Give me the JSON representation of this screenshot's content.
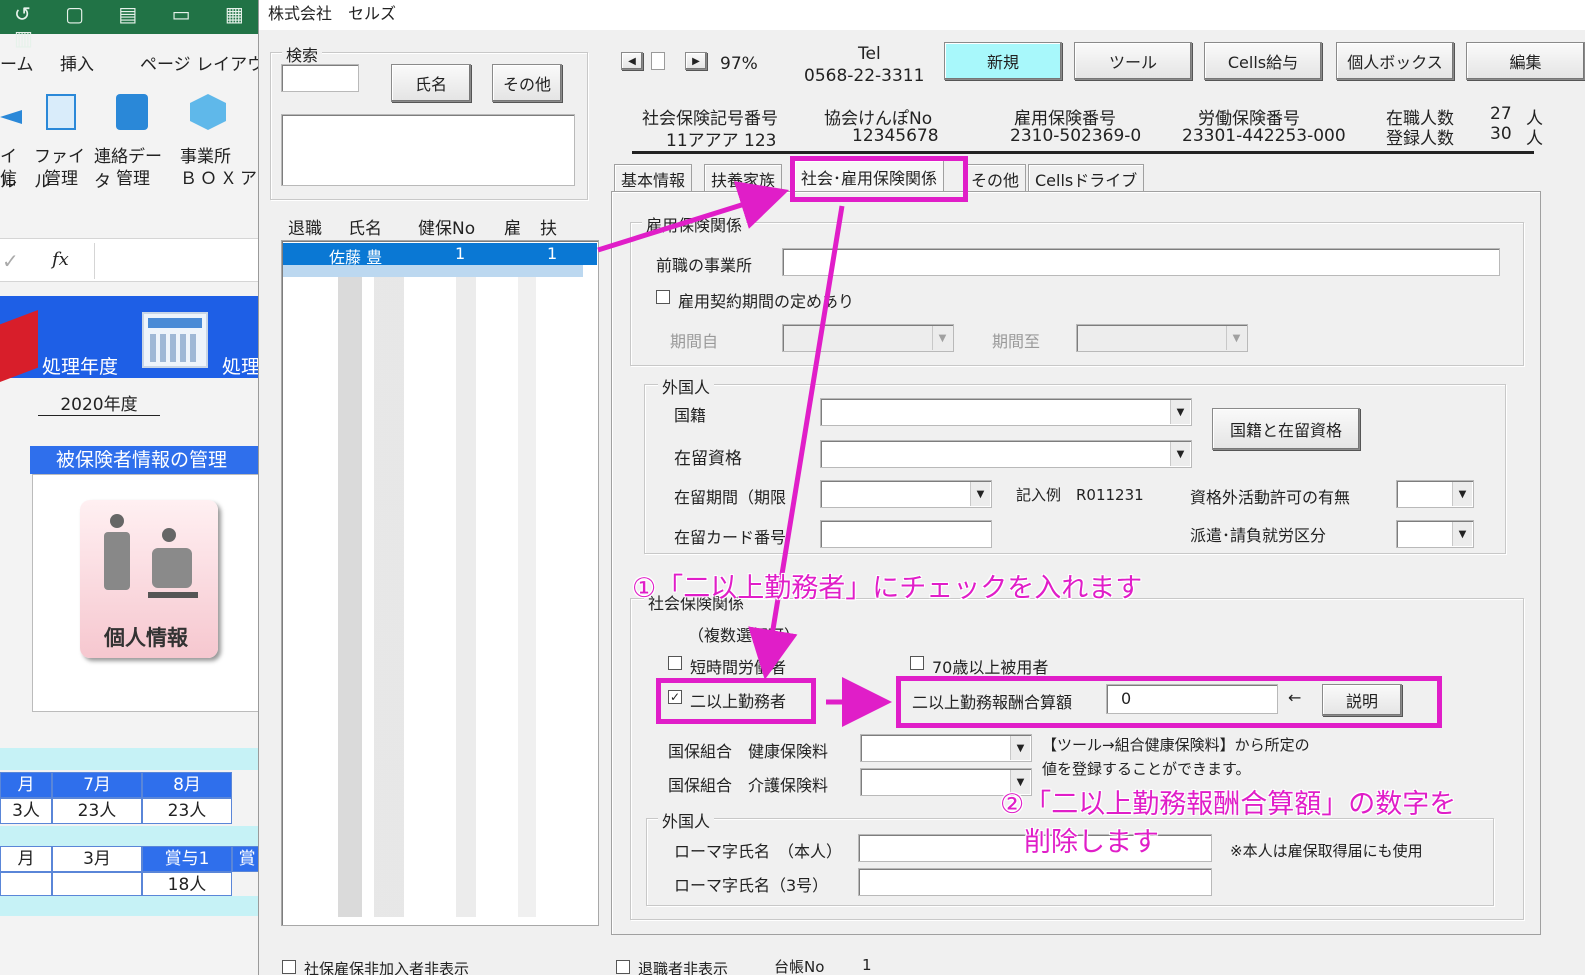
{
  "window": {
    "title": "株式会社　セルズ"
  },
  "excel": {
    "ribbon_tabs": [
      "ーム",
      "挿入",
      "ページ レイアウ"
    ],
    "ribbon_buttons": [
      {
        "line1": "イル",
        "line2": "信"
      },
      {
        "line1": "ファイル",
        "line2": "管理"
      },
      {
        "line1": "連絡データ",
        "line2": "管理"
      },
      {
        "line1": "事業所",
        "line2": "ＢＯＸ"
      },
      {
        "line1": "",
        "line2": "ア"
      }
    ],
    "formula_fx": "fx",
    "year_label": "処理年度",
    "year_label_2": "処理",
    "year_value": "2020年度",
    "section_title": "被保険者情報の管理",
    "personal_info_button": "個人情報",
    "months_row1": [
      "月",
      "7月",
      "8月"
    ],
    "counts_row1": [
      "3人",
      "23人",
      "23人"
    ],
    "months_row2": [
      "月",
      "3月",
      "賞与1",
      "賞"
    ],
    "counts_row2": [
      "",
      "",
      "18人"
    ]
  },
  "search": {
    "group_label": "検索",
    "name_button": "氏名",
    "other_button": "その他"
  },
  "list": {
    "headers": [
      "退職",
      "氏名",
      "健保No",
      "雇",
      "扶"
    ],
    "selected_row": {
      "name": "佐藤 豊",
      "kenpo": "1",
      "fuyo": "1"
    }
  },
  "toolbar": {
    "zoom": "97%",
    "tel_label": "Tel",
    "tel_number": "0568-22-3311",
    "buttons": [
      "新規",
      "ツール",
      "Cells給与",
      "個人ボックス",
      "編集"
    ]
  },
  "info": {
    "shaho_label": "社会保険記号番号",
    "shaho_value": "11アアア 123",
    "kyokai_label": "協会けんぽNo",
    "kyokai_value": "12345678",
    "koyo_label": "雇用保険番号",
    "koyo_value": "2310-502369-0",
    "rodo_label": "労働保険番号",
    "rodo_value": "23301-442253-000",
    "zaishoku_label": "在職人数",
    "zaishoku_value": "27",
    "toroku_label": "登録人数",
    "toroku_value": "30",
    "unit": "人"
  },
  "tabs": [
    "基本情報",
    "扶養家族",
    "社会･雇用保険関係",
    "その他",
    "Cellsドライブ"
  ],
  "koyo_group": {
    "title": "雇用保険関係",
    "prev_office_label": "前職の事業所",
    "contract_check_label": "雇用契約期間の定めあり",
    "period_from_label": "期間自",
    "period_to_label": "期間至"
  },
  "foreign_group": {
    "title": "外国人",
    "nationality_label": "国籍",
    "status_label": "在留資格",
    "nat_status_button": "国籍と在留資格",
    "period_label": "在留期間（期限",
    "example_text": "記入例　R011231",
    "permission_label": "資格外活動許可の有無",
    "card_label": "在留カード番号",
    "dispatch_label": "派遣･請負就労区分"
  },
  "shakai_group": {
    "title": "社会保険関係",
    "multi_select_note": "（複数選択可）",
    "short_time_label": "短時間労働者",
    "age70_label": "70歳以上被用者",
    "multi_work_label": "二以上勤務者",
    "multi_work_checked": true,
    "combined_label": "二以上勤務報酬合算額",
    "combined_value": "0",
    "arrow": "←",
    "explain_button": "説明",
    "kokuho_kenko_label": "国保組合　健康保険料",
    "kokuho_kaigo_label": "国保組合　介護保険料",
    "note_line1": "【ツール→組合健康保険料】から所定の",
    "note_line2": "値を登録することができます。"
  },
  "foreign_group_2": {
    "title": "外国人",
    "roman_self_label": "ローマ字氏名　（本人）",
    "roman_3_label": "ローマ字氏名（3号）",
    "roman_note": "※本人は雇保取得届にも使用"
  },
  "bottom": {
    "left_check": "社保雇保非加入者非表示",
    "right_check": "退職者非表示",
    "daicho_label": "台帳No",
    "daicho_value": "1"
  },
  "annotations": {
    "step1": "①「二以上勤務者」にチェックを入れます",
    "step2_line1": "②「二以上勤務報酬合算額」の数字を",
    "step2_line2": "削除します",
    "color": "#e01ec8"
  }
}
